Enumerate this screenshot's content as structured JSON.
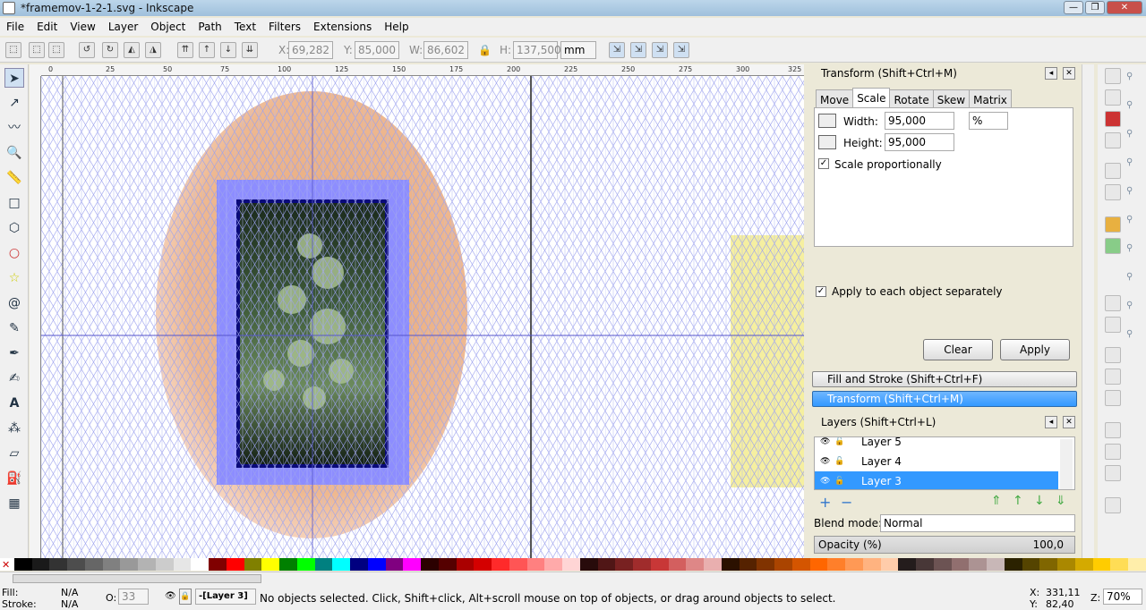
{
  "window": {
    "title": "*framemov-1-2-1.svg - Inkscape"
  },
  "menu": [
    "File",
    "Edit",
    "View",
    "Layer",
    "Object",
    "Path",
    "Text",
    "Filters",
    "Extensions",
    "Help"
  ],
  "controls": {
    "x_label": "X:",
    "x_value": "69,282",
    "y_label": "Y:",
    "y_value": "85,000",
    "w_label": "W:",
    "w_value": "86,602",
    "h_label": "H:",
    "h_value": "137,500",
    "unit": "mm"
  },
  "ruler": {
    "ticks": [
      "0",
      "25",
      "50",
      "75",
      "100",
      "125",
      "150",
      "175",
      "200",
      "225",
      "250",
      "275",
      "300",
      "325"
    ]
  },
  "transform": {
    "title": "Transform (Shift+Ctrl+M)",
    "tabs": [
      "Move",
      "Scale",
      "Rotate",
      "Skew",
      "Matrix"
    ],
    "active_tab": "Scale",
    "width_label": "Width:",
    "width_value": "95,000",
    "unit": "%",
    "height_label": "Height:",
    "height_value": "95,000",
    "scale_prop_label": "Scale proportionally",
    "scale_prop_checked": true,
    "apply_each_label": "Apply to each object separately",
    "apply_each_checked": true,
    "clear_label": "Clear",
    "apply_label": "Apply"
  },
  "collapsed": {
    "fill_stroke": "Fill and Stroke (Shift+Ctrl+F)",
    "transform": "Transform (Shift+Ctrl+M)"
  },
  "layers": {
    "title": "Layers (Shift+Ctrl+L)",
    "rows": [
      "Layer 5",
      "Layer 4",
      "Layer 3"
    ],
    "selected": "Layer 3",
    "blend_label": "Blend mode:",
    "blend_value": "Normal",
    "opacity_label": "Opacity (%)",
    "opacity_value": "100,0"
  },
  "status": {
    "fill_label": "Fill:",
    "fill_value": "N/A",
    "stroke_label": "Stroke:",
    "stroke_value": "N/A",
    "o_label": "O:",
    "o_value": "33",
    "layer": "-[Layer 3]",
    "message": "No objects selected. Click, Shift+click, Alt+scroll mouse on top of objects, or drag around objects to select.",
    "x_label": "X:",
    "x_value": "331,11",
    "y_label": "Y:",
    "y_value": "82,40",
    "zoom_label": "Z:",
    "zoom_value": "70%"
  },
  "colors": {
    "accent": "#3399ff",
    "selected_row": "#3399ff",
    "frame_blue": "#8888ff",
    "ellipse": "#e8b890",
    "yellow": "#f5f0a0"
  }
}
